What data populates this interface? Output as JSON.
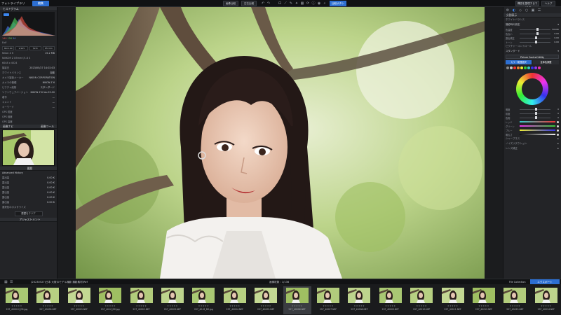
{
  "app": {
    "title": "フォトライブラリ",
    "active_tab": "編集"
  },
  "topbar": {
    "buttons": [
      "画像比較",
      "左右比較",
      "画面に合わせる",
      "比較ボタン"
    ],
    "right_buttons": [
      "構図を整理するマイスタ",
      "ヘルプ"
    ]
  },
  "left_panel": {
    "histogram_header": "ヒストグラム",
    "rgb": {
      "r": "140",
      "g": "126",
      "b": "54"
    },
    "exif_mode": "ExIf",
    "exif_buttons": [
      "ISO 100",
      "1/125",
      "f/2.8",
      "85 mm"
    ],
    "info_rows": [
      {
        "k": "Nikon Z 6",
        "v": "15.2 MB"
      },
      {
        "k": "NIKKOR Z 85mm f/1.8 S",
        "v": ""
      },
      {
        "k": "6048 x 4024",
        "v": ""
      }
    ],
    "meta_header": "メタデータ",
    "meta_rows": [
      {
        "k": "撮影日",
        "v": "2023/05/27 14:02:03"
      },
      {
        "k": "ホワイトバランス",
        "v": "自動"
      },
      {
        "k": "カメラ製造メーカー",
        "v": "NIKON CORPORATION"
      },
      {
        "k": "カメラの機種",
        "v": "NIKON Z 6"
      },
      {
        "k": "ピクチャ統制",
        "v": "スタンダード"
      },
      {
        "k": "ソフトウェアバージョン",
        "v": "NIKON Z 6 Ver.03.00"
      },
      {
        "k": "著作",
        "v": "—"
      },
      {
        "k": "コメント",
        "v": "—"
      },
      {
        "k": "キーワード",
        "v": "—"
      }
    ],
    "gps_rows": [
      {
        "k": "GPS 緯度",
        "v": ""
      },
      {
        "k": "GPS 経度",
        "v": ""
      },
      {
        "k": "GPS 高度",
        "v": ""
      }
    ],
    "nav_header": "画像ナビ",
    "nav_header_right": "画像ツール",
    "history_header": "履歴",
    "history_sub": "Advanced History",
    "history_rows": [
      {
        "k": "露出量",
        "v": "0.00 K"
      },
      {
        "k": "露出量",
        "v": "0.00 K"
      },
      {
        "k": "露出量",
        "v": "0.00 K"
      },
      {
        "k": "露出量",
        "v": "0.00 K"
      },
      {
        "k": "露出量",
        "v": "0.00 K"
      },
      {
        "k": "露出量",
        "v": "0.00 K"
      },
      {
        "k": "選択色のポスタライズ",
        "v": ""
      }
    ],
    "clear_history": "履歴をクリア",
    "adjust_header": "アジャストメント"
  },
  "right_panel": {
    "section1": "分割表示",
    "sub1": "ホワイトバランス",
    "wb_mode": "撮影時の設定",
    "sliders1": [
      {
        "label": "色温度",
        "value": "5010K"
      },
      {
        "label": "色合い",
        "value": "0.00"
      }
    ],
    "sliders2": [
      {
        "label": "露出補正",
        "value": "0.00"
      },
      {
        "label": "トーン",
        "value": "0.00"
      }
    ],
    "picture_control": "ピクチャーコントロール",
    "pc_mode": "スタンダード",
    "apply_btn": "Picture Control Utility",
    "colortabs": [
      "カラー範囲選択",
      "全体色調整"
    ],
    "wheel_sliders": [
      {
        "label": "明度",
        "value": "0"
      },
      {
        "label": "彩度",
        "value": "0"
      },
      {
        "label": "色相",
        "value": "0"
      }
    ],
    "balance_rows": [
      "レッド",
      "グリーン",
      "ブルー",
      "明るさ"
    ],
    "misc_rows": [
      "シャープネス",
      "ノイズリダクション",
      "レンズ補正"
    ],
    "swatch_colors": [
      "#888",
      "#ccc",
      "#e33",
      "#e83",
      "#ee3",
      "#3c3",
      "#3cc",
      "#33e",
      "#93e",
      "#e3a"
    ]
  },
  "filmbar": {
    "path": "(20230527)日本 大阪のモデル撮影 撮影素材(Ref",
    "count": "画像枚数 : 1/136",
    "filter": "File Collection",
    "export": "エクスポート"
  },
  "filmstrip": [
    {
      "name": "297_4000-M_DS.jpg"
    },
    {
      "name": "297_40000.NEF"
    },
    {
      "name": "297_40001.NEF"
    },
    {
      "name": "297_40-M_DS.jpg"
    },
    {
      "name": "297_40002.NEF"
    },
    {
      "name": "297_40003.NEF"
    },
    {
      "name": "297_40-M_DS.jpg"
    },
    {
      "name": "297_40004.NEF"
    },
    {
      "name": "297_40005.NEF"
    },
    {
      "name": "297_40006.NEF"
    },
    {
      "name": "297_40007.NEF"
    },
    {
      "name": "297_40008.NEF"
    },
    {
      "name": "297_40009.NEF"
    },
    {
      "name": "297_40010.NEF"
    },
    {
      "name": "297_40011.NEF"
    },
    {
      "name": "297_40012.NEF"
    },
    {
      "name": "297_40013.NEF"
    },
    {
      "name": "297_40014.NEF"
    }
  ]
}
